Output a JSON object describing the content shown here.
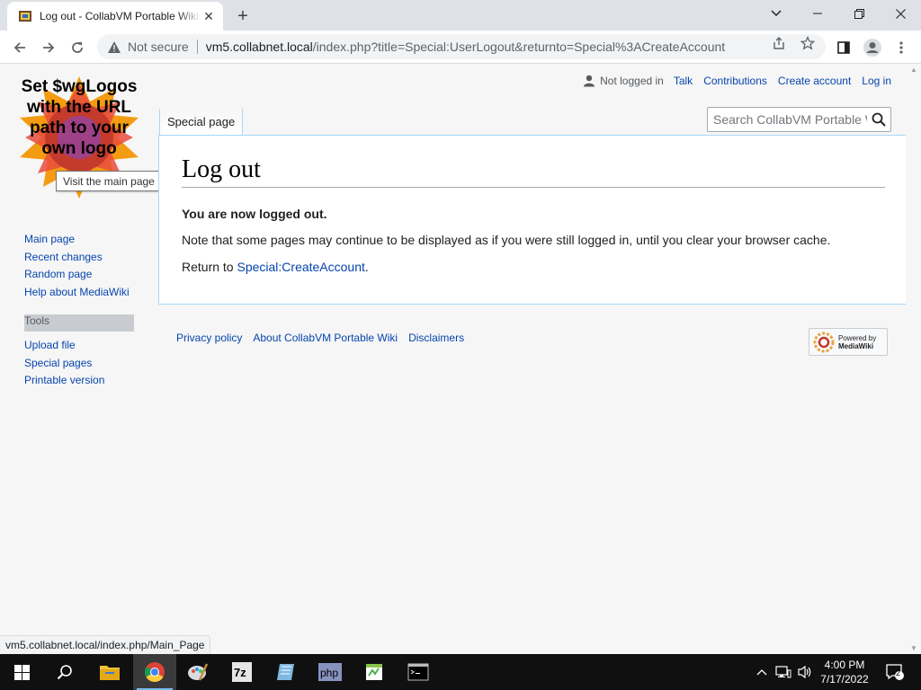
{
  "browser": {
    "tab_title": "Log out - CollabVM Portable Wiki",
    "new_tab": "+",
    "tab_close": "✕",
    "not_secure": "Not secure",
    "url_host": "vm5.collabnet.local",
    "url_path": "/index.php?title=Special:UserLogout&returnto=Special%3ACreateAccount",
    "status_url": "vm5.collabnet.local/index.php/Main_Page"
  },
  "wiki": {
    "logo_text": "Set $wgLogos with the URL path to your own logo",
    "logo_tooltip": "Visit the main page",
    "personal": {
      "not_logged_in": "Not logged in",
      "talk": "Talk",
      "contributions": "Contributions",
      "create_account": "Create account",
      "log_in": "Log in"
    },
    "namespace_tab": "Special page",
    "search_placeholder": "Search CollabVM Portable Wiki",
    "heading": "Log out",
    "logged_out_msg": "You are now logged out.",
    "cache_note": "Note that some pages may continue to be displayed as if you were still logged in, until you clear your browser cache.",
    "return_prefix": "Return to ",
    "return_link": "Special:CreateAccount",
    "return_suffix": ".",
    "nav_main": [
      "Main page",
      "Recent changes",
      "Random page",
      "Help about MediaWiki"
    ],
    "tools_heading": "Tools",
    "nav_tools": [
      "Upload file",
      "Special pages",
      "Printable version"
    ],
    "footer": [
      "Privacy policy",
      "About CollabVM Portable Wiki",
      "Disclaimers"
    ],
    "powered_by_small": "Powered by",
    "powered_by": "MediaWiki"
  },
  "taskbar": {
    "time": "4:00 PM",
    "date": "7/17/2022",
    "notification_count": "2",
    "apps": [
      "start",
      "search",
      "file-explorer",
      "chrome",
      "paint",
      "7zip",
      "notepad",
      "php",
      "notepad-plus",
      "terminal"
    ]
  }
}
